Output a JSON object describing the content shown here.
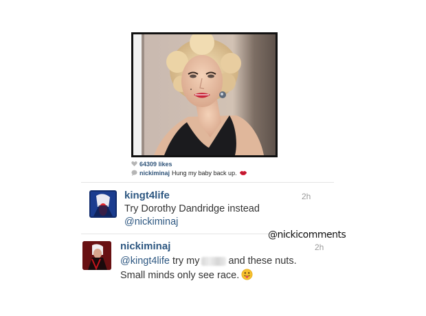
{
  "post": {
    "likes": "64309 likes",
    "caption_user": "nickiminaj",
    "caption_text": "Hung my baby back up."
  },
  "comments": [
    {
      "username": "kingt4life",
      "time": "2h",
      "line1": "Try Dorothy Dandridge instead",
      "line2": "@nickiminaj"
    },
    {
      "username": "nickiminaj",
      "time": "2h",
      "mention": "@kingt4life",
      "line1_a": " try my",
      "line1_b": "and these nuts.",
      "line2": "Small minds only see race."
    }
  ],
  "watermark": "@nickicomments",
  "colors": {
    "username_blue": "#2d5781",
    "time_gray": "#9a9a9a",
    "text": "#333333"
  },
  "icons": {
    "likes": "heart-icon",
    "caption": "speech-bubble-icon",
    "caption_emoji": "kiss-lips-icon",
    "reply_emoji": "tongue-out-emoji-icon"
  }
}
